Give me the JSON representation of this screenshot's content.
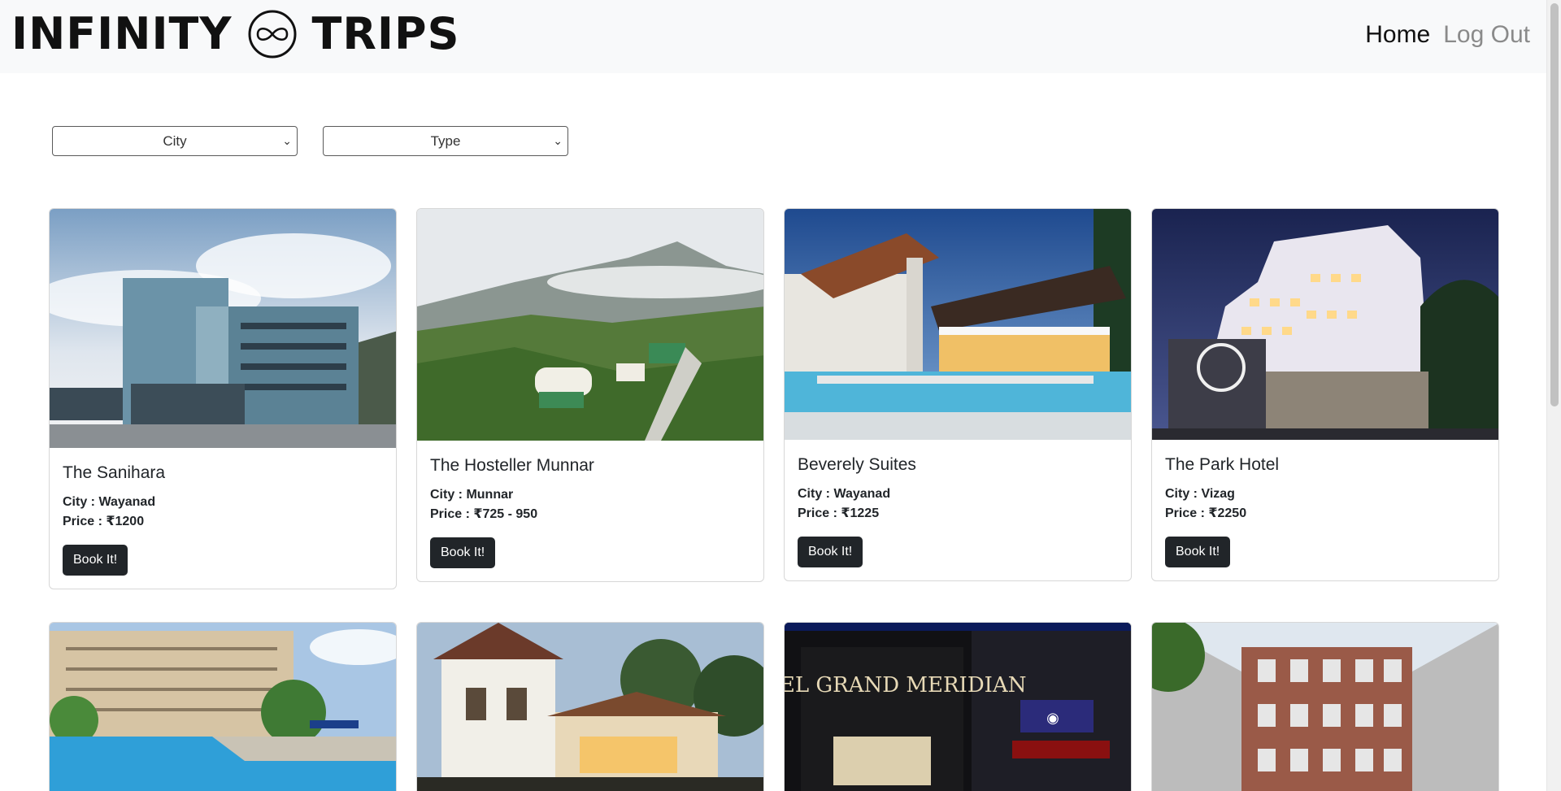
{
  "brand": {
    "left_word": "INFINITY",
    "right_word": "TRIPS",
    "logo_icon": "infinity-circle-icon"
  },
  "nav": {
    "home": "Home",
    "logout": "Log Out"
  },
  "filters": {
    "city": "City",
    "type": "Type"
  },
  "hotels": [
    {
      "name": "The Sanihara",
      "city": "City : Wayanad",
      "price": "Price : ₹1200",
      "button": "Book It!",
      "image": "blue-building-photo"
    },
    {
      "name": "The Hosteller Munnar",
      "city": "City : Munnar",
      "price": "Price : ₹725 - 950",
      "button": "Book It!",
      "image": "hillside-cottages-photo"
    },
    {
      "name": "Beverely Suites",
      "city": "City : Wayanad",
      "price": "Price : ₹1225",
      "button": "Book It!",
      "image": "pool-villa-photo"
    },
    {
      "name": "The Park Hotel",
      "city": "City : Vizag",
      "price": "Price : ₹2250",
      "button": "Book It!",
      "image": "lit-hotel-night-photo"
    },
    {
      "image": "resort-pool-photo"
    },
    {
      "image": "heritage-villa-photo"
    },
    {
      "image": "grand-meridian-facade-photo",
      "sign": "HOTEL GRAND MERIDIAN"
    },
    {
      "image": "brick-building-courtyard-photo"
    }
  ],
  "colors": {
    "navbar_bg": "#f8f9fa",
    "button_bg": "#212529",
    "link_muted": "#8a8a8a"
  }
}
